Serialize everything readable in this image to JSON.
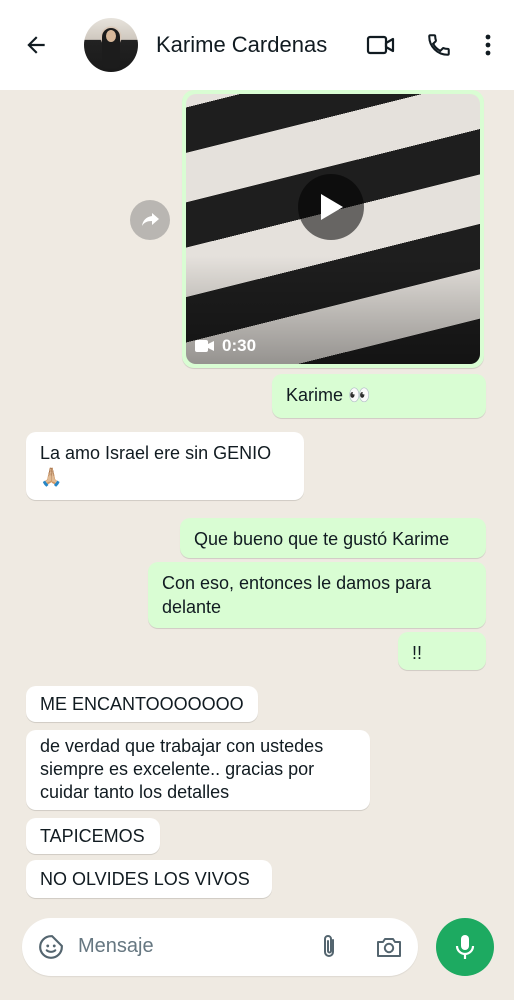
{
  "header": {
    "contact_name": "Karime Cardenas"
  },
  "icons": {
    "back": "arrow-left-icon",
    "video_call": "video-camera-icon",
    "voice_call": "phone-icon",
    "menu": "more-vertical-icon",
    "forward": "forward-icon",
    "play": "play-icon",
    "sticker": "sticker-icon",
    "attach": "paperclip-icon",
    "camera": "camera-icon",
    "mic": "microphone-icon"
  },
  "video": {
    "duration": "0:30"
  },
  "messages": [
    {
      "id": "m1",
      "direction": "out",
      "text": "Karime 👀"
    },
    {
      "id": "m2",
      "direction": "in",
      "line1": "La amo Israel ere sin GENIO",
      "line2": "🙏🏼"
    },
    {
      "id": "m3",
      "direction": "out",
      "text": "Que bueno que te gustó Karime"
    },
    {
      "id": "m4",
      "direction": "out",
      "line1": "Con eso, entonces le damos para",
      "line2": "delante"
    },
    {
      "id": "m5",
      "direction": "out",
      "text": "!!"
    },
    {
      "id": "m6",
      "direction": "in",
      "text": "ME ENCANTOOOOOOO"
    },
    {
      "id": "m7",
      "direction": "in",
      "line1": "de verdad que trabajar con ustedes",
      "line2": "siempre es excelente.. gracias por",
      "line3": "cuidar tanto los detalles"
    },
    {
      "id": "m8",
      "direction": "in",
      "text": "TAPICEMOS"
    },
    {
      "id": "m9",
      "direction": "in",
      "text": "NO OLVIDES LOS VIVOS"
    }
  ],
  "composer": {
    "placeholder": "Mensaje"
  },
  "colors": {
    "outgoing_bubble": "#d9fdd3",
    "incoming_bubble": "#ffffff",
    "chat_background": "#efeae2",
    "accent_green": "#1daa61"
  }
}
